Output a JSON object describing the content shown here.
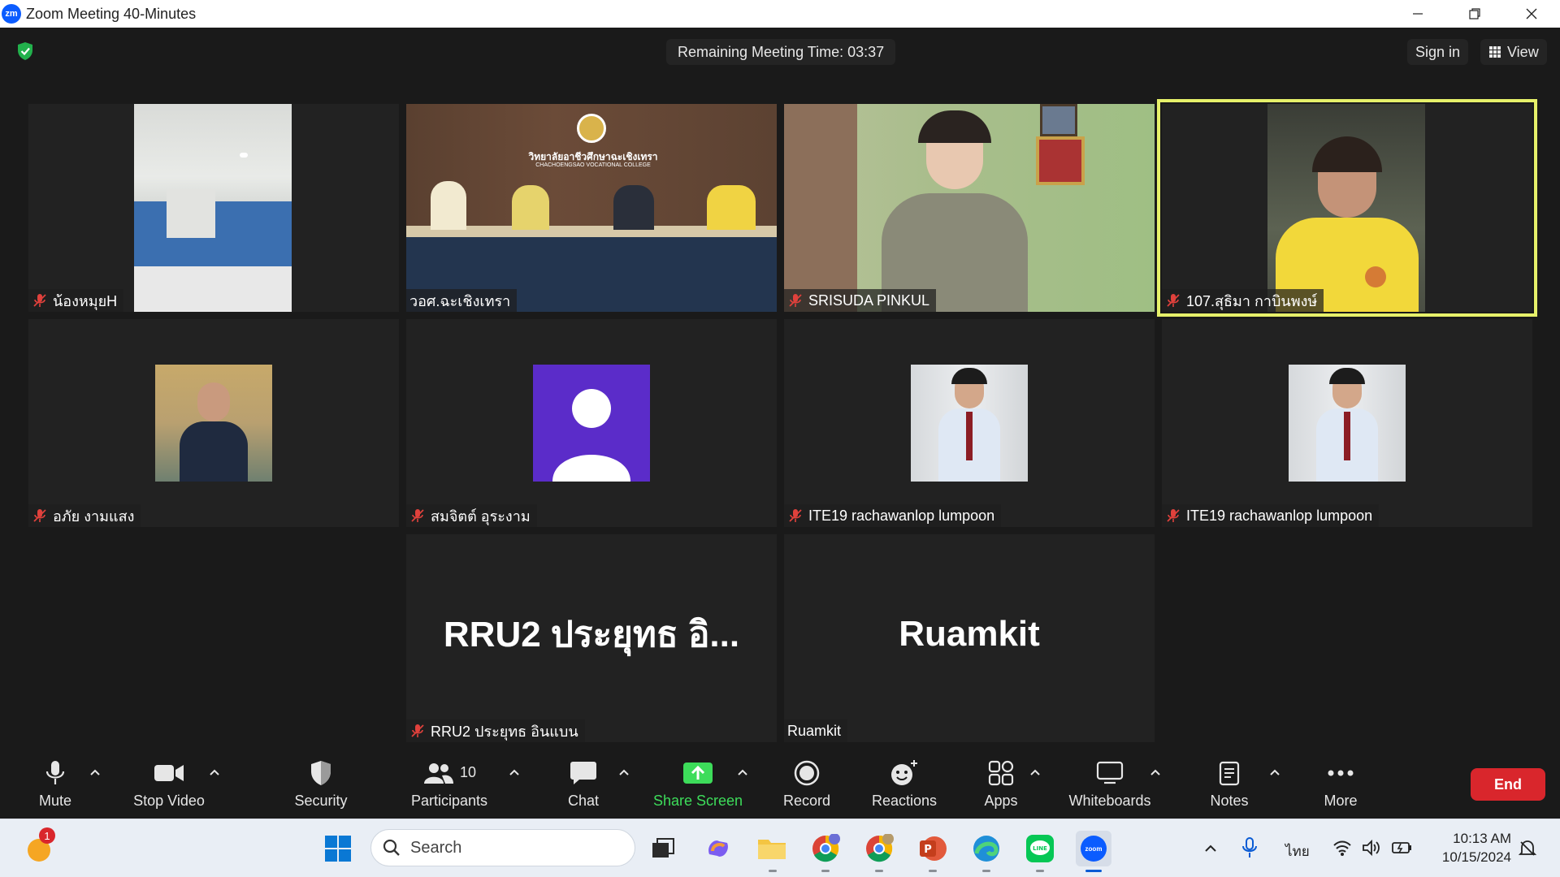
{
  "window": {
    "title": "Zoom Meeting 40-Minutes",
    "logo_text": "zm"
  },
  "topbar": {
    "timer": "Remaining Meeting Time: 03:37",
    "sign_in": "Sign in",
    "view": "View"
  },
  "participants": [
    {
      "name": "น้องหมุยH",
      "muted": true
    },
    {
      "name": "วอศ.ฉะเชิงเทรา",
      "muted": false
    },
    {
      "name": "SRISUDA PINKUL",
      "muted": true
    },
    {
      "name": "107.สุธิมา กาบินพงษ์",
      "muted": true,
      "active_speaker": true
    },
    {
      "name": "อภัย งามแสง",
      "muted": true
    },
    {
      "name": "สมจิตต์ อุระงาม",
      "muted": true
    },
    {
      "name": "ITE19 rachawanlop lumpoon",
      "muted": true
    },
    {
      "name": "ITE19 rachawanlop lumpoon",
      "muted": true
    },
    {
      "name": "RRU2 ประยุทธ อินแบน",
      "muted": true,
      "display": "RRU2 ประยุทธ อิ..."
    },
    {
      "name": "Ruamkit",
      "muted": false,
      "display": "Ruamkit"
    }
  ],
  "video_texts": {
    "college_thai": "วิทยาลัยอาชีวศึกษาฉะเชิงเทรา",
    "college_en": "CHACHOENGSAO VOCATIONAL COLLEGE"
  },
  "toolbar": {
    "mute": "Mute",
    "stop_video": "Stop Video",
    "security": "Security",
    "participants": "Participants",
    "participants_count": "10",
    "chat": "Chat",
    "share_screen": "Share Screen",
    "record": "Record",
    "reactions": "Reactions",
    "apps": "Apps",
    "whiteboards": "Whiteboards",
    "notes": "Notes",
    "more": "More",
    "end": "End"
  },
  "taskbar": {
    "search_placeholder": "Search",
    "notification_badge": "1",
    "language": "ไทย",
    "time": "10:13 AM",
    "date": "10/15/2024",
    "zoom_icon_text": "zoom"
  },
  "colors": {
    "active_speaker": "#e6f06a",
    "end_button": "#d9262c",
    "share_green": "#3ddc5a",
    "muted_red": "#e0413c",
    "avatar_purple": "#5b2cc9"
  }
}
